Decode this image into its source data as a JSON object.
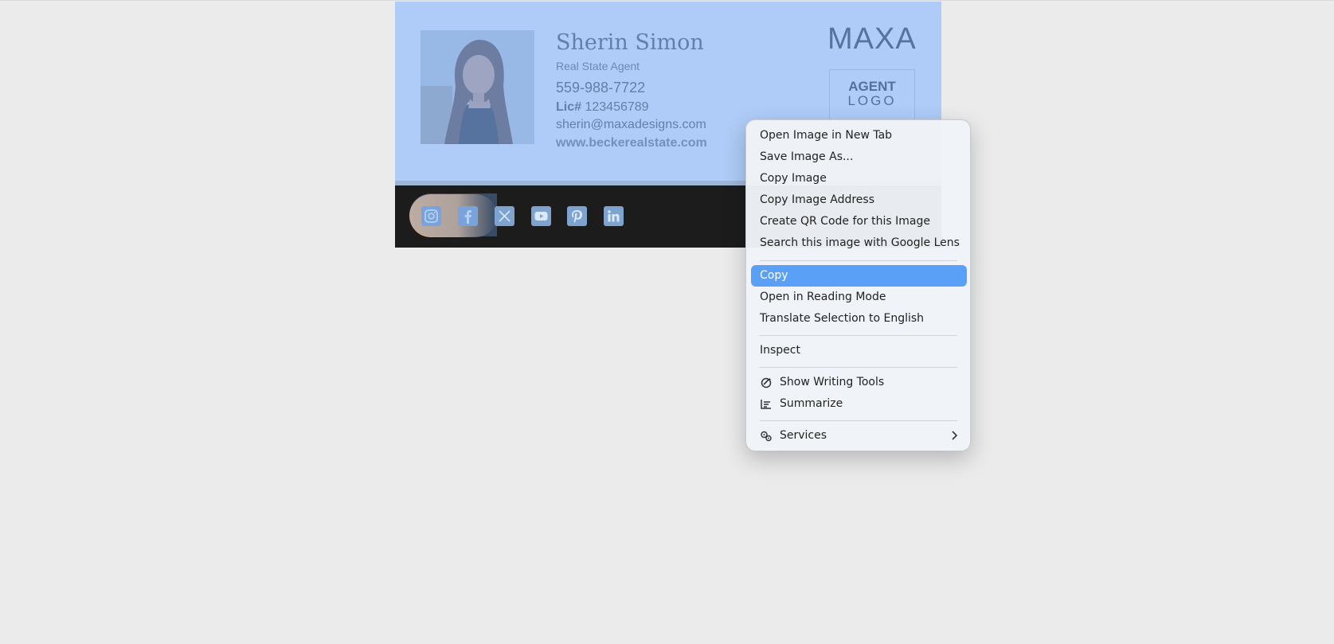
{
  "signature": {
    "name": "Sherin Simon",
    "title": "Real State Agent",
    "phone": "559-988-7722",
    "license_label": "Lic#",
    "license_number": "123456789",
    "email": "sherin@maxadesigns.com",
    "website": "www.beckerealstate.com",
    "brand_logo": "MAXA",
    "agent_logo_top": "AGENT",
    "agent_logo_bottom": "LOGO",
    "social_icons": [
      "instagram-icon",
      "facebook-icon",
      "x-icon",
      "youtube-icon",
      "pinterest-icon",
      "linkedin-icon"
    ]
  },
  "context_menu": {
    "group1": [
      "Open Image in New Tab",
      "Save Image As...",
      "Copy Image",
      "Copy Image Address",
      "Create QR Code for this Image",
      "Search this image with Google Lens"
    ],
    "group2": [
      "Copy",
      "Open in Reading Mode",
      "Translate Selection to English"
    ],
    "group3": [
      "Inspect"
    ],
    "group4": [
      {
        "label": "Show Writing Tools",
        "icon": "writing-tools-icon"
      },
      {
        "label": "Summarize",
        "icon": "summarize-icon"
      }
    ],
    "group5": [
      {
        "label": "Services",
        "icon": "services-icon",
        "submenu": true
      }
    ],
    "highlighted_item": "Copy"
  },
  "colors": {
    "selection": "#6ca3f0",
    "menu_highlight": "#5aa0f7",
    "footer_bg": "#1c1c1c",
    "social_pill": "#e7b27b"
  }
}
